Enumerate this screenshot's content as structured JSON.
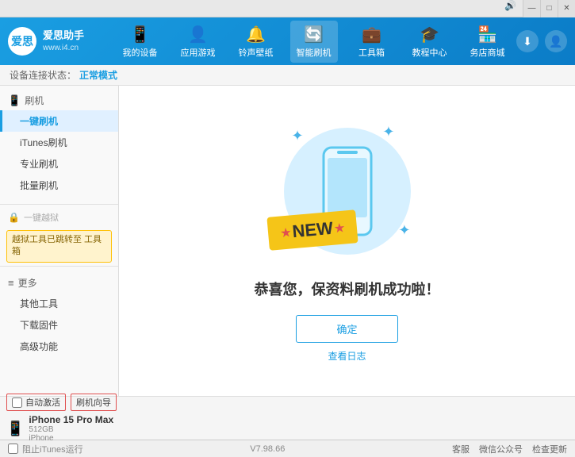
{
  "window": {
    "controls": [
      "—",
      "□",
      "✕"
    ]
  },
  "topbar": {
    "icons": [
      "🔊",
      "⊞",
      "—",
      "□",
      "✕"
    ]
  },
  "logo": {
    "inner": "爱思",
    "name": "爱思助手",
    "url": "www.i4.cn"
  },
  "nav": {
    "items": [
      {
        "id": "my-device",
        "icon": "📱",
        "label": "我的设备"
      },
      {
        "id": "apps-games",
        "icon": "👤",
        "label": "应用游戏"
      },
      {
        "id": "ringtones",
        "icon": "🔔",
        "label": "铃声壁纸"
      },
      {
        "id": "smart-flash",
        "icon": "🔄",
        "label": "智能刷机",
        "active": true
      },
      {
        "id": "toolbox",
        "icon": "💼",
        "label": "工具箱"
      },
      {
        "id": "tutorials",
        "icon": "🎓",
        "label": "教程中心"
      },
      {
        "id": "services",
        "icon": "🏪",
        "label": "务店商城"
      }
    ]
  },
  "statusbar": {
    "label": "设备连接状态：",
    "value": "正常模式"
  },
  "sidebar": {
    "section1": {
      "icon": "📱",
      "label": "刷机",
      "items": [
        {
          "id": "onekey-flash",
          "label": "一键刷机",
          "active": true
        },
        {
          "id": "itunes-flash",
          "label": "iTunes刷机"
        },
        {
          "id": "pro-flash",
          "label": "专业刷机"
        },
        {
          "id": "batch-flash",
          "label": "批量刷机"
        }
      ]
    },
    "disabled": {
      "icon": "🔒",
      "label": "一键越狱"
    },
    "notice": "越狱工具已跳转至\n工具箱",
    "section2": {
      "icon": "≡",
      "label": "更多",
      "items": [
        {
          "id": "other-tools",
          "label": "其他工具"
        },
        {
          "id": "download-fw",
          "label": "下载固件"
        },
        {
          "id": "advanced",
          "label": "高级功能"
        }
      ]
    }
  },
  "content": {
    "new_badge": "NEW",
    "success_text": "恭喜您，保资料刷机成功啦！",
    "confirm_btn": "确定",
    "log_link": "查看日志"
  },
  "device_bar": {
    "auto_activate": "自动激活",
    "guide": "刷机向导",
    "device_name": "iPhone 15 Pro Max",
    "device_storage": "512GB",
    "device_type": "iPhone",
    "itunes_label": "阻止iTunes运行"
  },
  "footer": {
    "version": "V7.98.66",
    "links": [
      "客服",
      "微信公众号",
      "检查更新"
    ]
  }
}
